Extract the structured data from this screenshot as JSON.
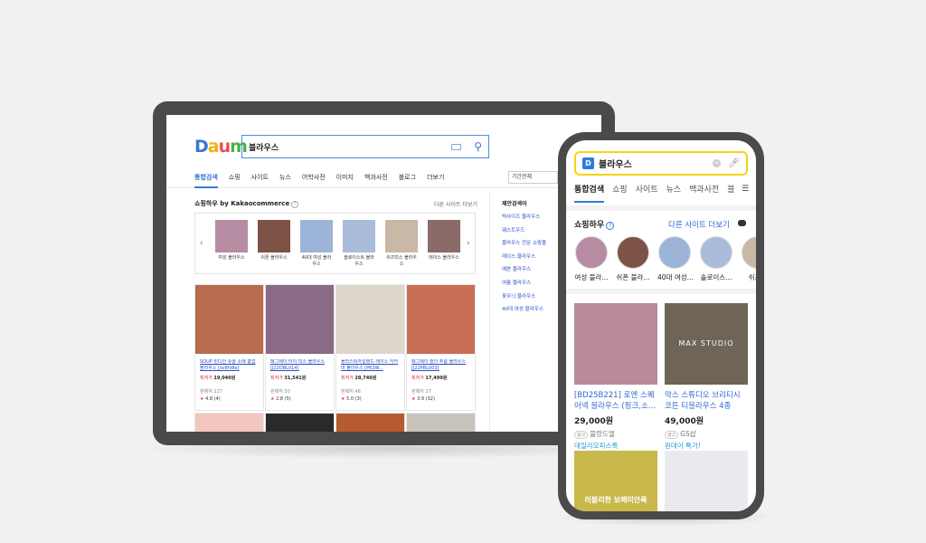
{
  "tablet": {
    "logo": "Daum",
    "query": "블라우스",
    "tabs": [
      "통합검색",
      "쇼핑",
      "사이트",
      "뉴스",
      "어학사전",
      "이미지",
      "백과사전",
      "블로그",
      "더보기"
    ],
    "period": "기간전체",
    "section_title": "쇼핑하우 by Kakaocommerce",
    "other_sites": "다른 사이트 더보기",
    "categories": [
      {
        "label": "여성 블라우스",
        "color": "#b58ca2"
      },
      {
        "label": "쉬폰 블라우스",
        "color": "#7d5247"
      },
      {
        "label": "40대 여성 블라우스",
        "color": "#9cb4d8"
      },
      {
        "label": "솔로이스트 블라우스",
        "color": "#a9bddb"
      },
      {
        "label": "쉬즈미스 블라우스",
        "color": "#c9b8a6"
      },
      {
        "label": "레이스 블라우스",
        "color": "#8b6a6a"
      }
    ],
    "products": [
      {
        "title": "SOUP 린디안 슈슬 소매 홈업 블라우스 [sv8hi8e]",
        "price_label": "최저가",
        "price": "19,040원",
        "seller_label": "판매처",
        "seller_count": "227",
        "rating": "4.8",
        "reviews": "(4)",
        "color": "#b86b4d"
      },
      {
        "title": "매그제이 타이 빅스 블라우스 [J22OBL014]",
        "price_label": "최저가",
        "price": "31,541원",
        "seller_label": "판매처",
        "seller_count": "50",
        "rating": "2.8",
        "reviews": "(5)",
        "color": "#8b6a86"
      },
      {
        "title": "플라스틱아일랜드 레이스 익커마 블라우스 [PK3W...",
        "price_label": "최저가",
        "price": "28,740원",
        "seller_label": "판매처",
        "seller_count": "46",
        "rating": "5.0",
        "reviews": "(3)",
        "color": "#ddd6cc"
      },
      {
        "title": "메그제이 슬더 주름 블라우스 [J22PBL003]",
        "price_label": "최저가",
        "price": "17,499원",
        "seller_label": "판매처",
        "seller_count": "27",
        "rating": "3.9",
        "reviews": "(32)",
        "color": "#c96f55"
      }
    ],
    "row2_colors": [
      "#f2c6bd",
      "#2a2a2a",
      "#b85a30",
      "#c8c4bc"
    ],
    "related_title": "제안검색어",
    "related": [
      "빅사이즈 블라우스",
      "웨스트우드",
      "블라우스 전문 쇼핑몰",
      "레이스 블라우스",
      "예쁜 블라우스",
      "여름 블라우스",
      "꽃무늬 블라우스",
      "40대 여성 블라우스"
    ]
  },
  "phone": {
    "logo_letter": "D",
    "query": "블라우스",
    "tabs": [
      "통합검색",
      "쇼핑",
      "사이트",
      "뉴스",
      "백과사전",
      "블"
    ],
    "section_title": "쇼핑하우",
    "other_sites": "다른 사이트 더보기",
    "categories": [
      {
        "label": "여성 블라...",
        "color": "#b58ca2"
      },
      {
        "label": "쉬폰 블라...",
        "color": "#7d5247"
      },
      {
        "label": "40대 여성...",
        "color": "#9cb4d8"
      },
      {
        "label": "솔로이스...",
        "color": "#a9bddb"
      },
      {
        "label": "쉬즈미",
        "color": "#c9b8a6"
      }
    ],
    "products": [
      {
        "title": "[BD25B221] 로엔 스퀘어넥 블라우스 (핑크,소...",
        "price": "29,000원",
        "badge": "광고",
        "seller": "블랑드엘",
        "mall": "데일리오피스룩",
        "color": "#b88a9c"
      },
      {
        "title": "막스 스튜디오 브리티시 코튼 티블라우스 4종",
        "price": "49,000원",
        "badge": "광고",
        "seller": "GS샵",
        "mall": "원데이 특가!",
        "color": "#6e6458",
        "brand_overlay": "MAX STUDIO"
      }
    ],
    "row2": [
      {
        "overlay": "러블리한 보헤미안룩",
        "color": "#c9b84a"
      },
      {
        "overlay": "",
        "color": "#e9e9ee"
      }
    ]
  }
}
